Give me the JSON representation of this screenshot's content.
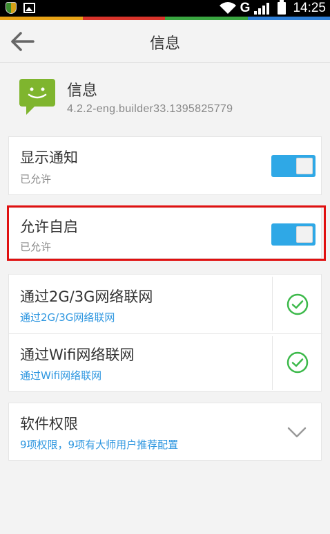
{
  "status_bar": {
    "network": "G",
    "time": "14:25"
  },
  "header": {
    "title": "信息"
  },
  "app": {
    "name": "信息",
    "version": "4.2.2-eng.builder33.1395825779"
  },
  "settings": {
    "show_notification": {
      "title": "显示通知",
      "status": "已允许",
      "enabled": true
    },
    "auto_start": {
      "title": "允许自启",
      "status": "已允许",
      "enabled": true
    }
  },
  "network": {
    "mobile": {
      "title": "通过2G/3G网络联网",
      "subtitle": "通过2G/3G网络联网",
      "allowed": true
    },
    "wifi": {
      "title": "通过Wifi网络联网",
      "subtitle": "通过Wifi网络联网",
      "allowed": true
    }
  },
  "permissions": {
    "title": "软件权限",
    "summary": "9项权限，9项有大师用户推荐配置"
  },
  "colors": {
    "accent": "#2fa8e6",
    "link": "#2f97e0",
    "check": "#3cb94a",
    "highlight": "#e01010",
    "app_icon": "#7fb52e"
  }
}
